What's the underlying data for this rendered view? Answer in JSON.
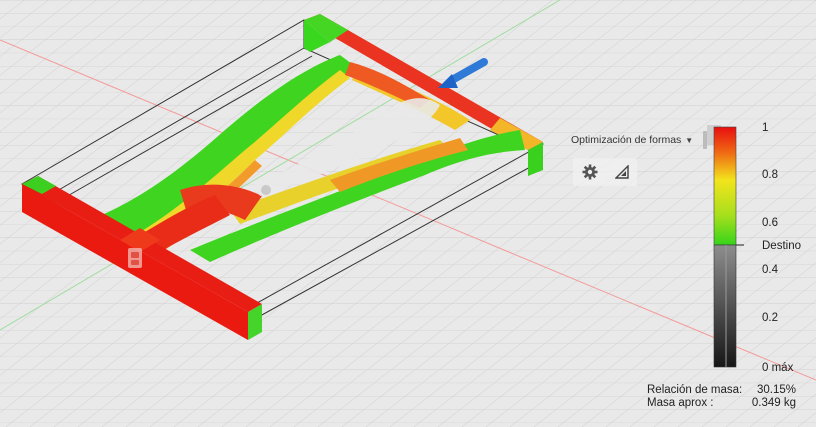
{
  "toolbar": {
    "mode_label": "Optimización de formas",
    "settings_icon": "gear-icon",
    "view_icon": "triangle-ruler-icon"
  },
  "colors": {
    "high": "#e80e0e",
    "mid": "#f2e41c",
    "low": "#35d41a",
    "below_target_top": "#8d8d8d",
    "below_target_bottom": "#161616",
    "background": "#e9e9e9"
  },
  "legend": {
    "labels": [
      "1",
      "0.8",
      "0.6",
      "0.4",
      "0.2"
    ],
    "target_label": "Destino",
    "bottom_label": "0 máx"
  },
  "stats": {
    "mass_ratio_label": "Relación de masa:",
    "mass_ratio_value": "30.15%",
    "mass_approx_label": "Masa aprox :",
    "mass_approx_value": "0.349 kg"
  }
}
